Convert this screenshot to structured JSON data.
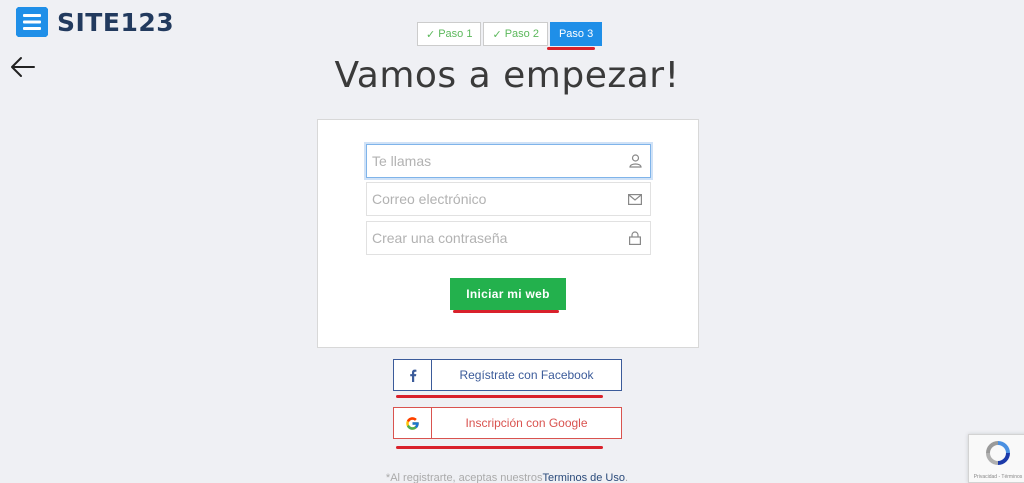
{
  "brand": {
    "name": "SITE123",
    "icon": "site123-logo-icon"
  },
  "nav": {
    "back_icon": "arrow-left-icon"
  },
  "steps": [
    {
      "label": "Paso 1",
      "icon": "check-icon",
      "state": "done"
    },
    {
      "label": "Paso 2",
      "icon": "check-icon",
      "state": "done"
    },
    {
      "label": "Paso 3",
      "state": "active"
    }
  ],
  "title": "Vamos a empezar!",
  "form": {
    "name_placeholder": "Te llamas",
    "email_placeholder": "Correo electrónico",
    "password_placeholder": "Crear una contraseña",
    "submit_label": "Iniciar mi web"
  },
  "social": {
    "facebook_label": "Regístrate con Facebook",
    "google_label": "Inscripción con Google"
  },
  "terms": {
    "prefix": "*Al registrarte, aceptas nuestros",
    "link": "Terminos de Uso",
    "suffix": "."
  },
  "recaptcha": {
    "text": "Privacidad - Términos"
  },
  "colors": {
    "accent_blue": "#1f8fe8",
    "cta_green": "#23b14d",
    "facebook": "#3b5b9a",
    "google_red": "#d9534f",
    "underline_red": "#d9212b"
  }
}
